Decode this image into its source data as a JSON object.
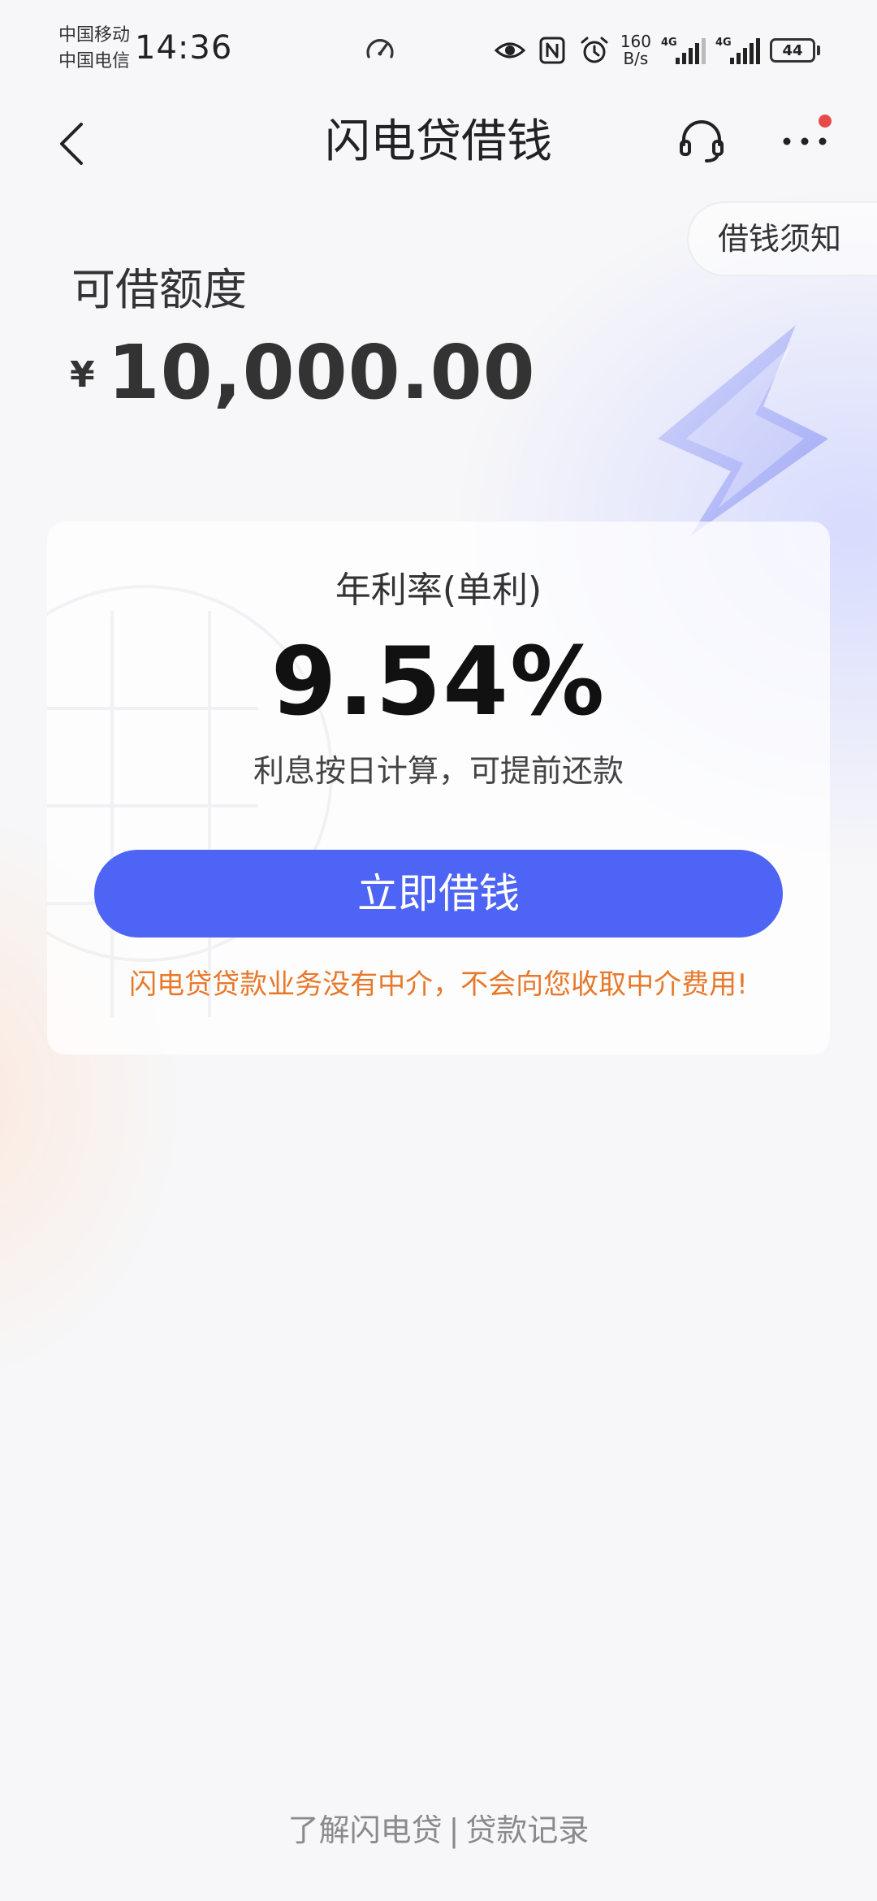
{
  "status_bar": {
    "carrier_1": "中国移动",
    "carrier_2": "中国电信",
    "time": "14:36",
    "net_speed_value": "160",
    "net_speed_unit": "B/s",
    "network_type_1": "4G",
    "network_type_2": "4G",
    "battery": "44"
  },
  "header": {
    "title": "闪电贷借钱",
    "back_icon": "chevron-left-icon",
    "service_icon": "headset-icon",
    "more_icon": "more-dots-icon"
  },
  "notice_button": "借钱须知",
  "limit": {
    "label": "可借额度",
    "currency": "¥",
    "amount": "10,000.00"
  },
  "card": {
    "rate_label": "年利率(单利)",
    "rate_value": "9.54%",
    "rate_desc": "利息按日计算，可提前还款",
    "borrow_button": "立即借钱",
    "warning": "闪电贷贷款业务没有中介，不会向您收取中介费用!"
  },
  "footer": {
    "link_about": "了解闪电贷",
    "separator": "|",
    "link_records": "贷款记录"
  },
  "colors": {
    "primary": "#4e64f5",
    "warning": "#e8782a",
    "badge": "#e84a4a"
  }
}
